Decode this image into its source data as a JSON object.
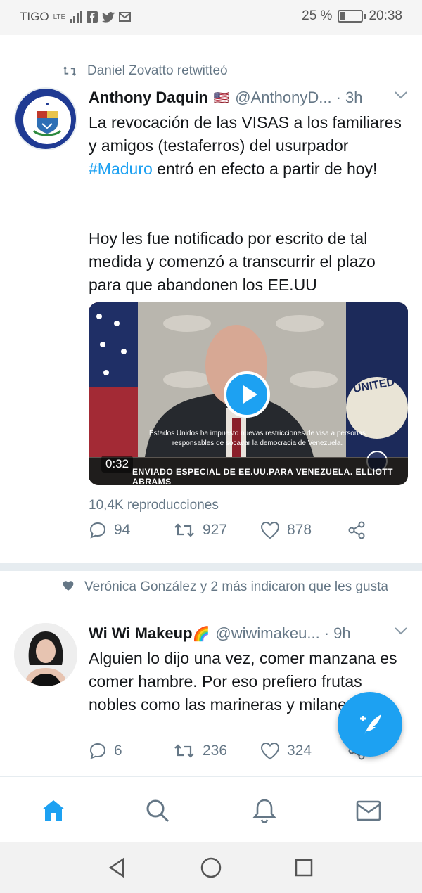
{
  "status_bar": {
    "carrier": "TIGO",
    "network": "LTE",
    "battery_percent": "25 %",
    "battery_level": 0.25,
    "time": "20:38"
  },
  "tweets": [
    {
      "context_icon": "retweet-icon",
      "context": "Daniel Zovatto retwitteó",
      "name": "Anthony Daquin",
      "flag": "🇺🇸",
      "handle": "@AnthonyD...",
      "time": "· 3h",
      "text_part1": "La revocación de las VISAS a los familiares y amigos (testaferros) del usurpador ",
      "hashtag": "#Maduro",
      "text_part2": " entró en efecto a partir de hoy!",
      "text_paragraph2": "Hoy les fue notificado por escrito de tal medida y comenzó a transcurrir el plazo para que abandonen los EE.UU",
      "media": {
        "duration": "0:32",
        "caption": "Estados Unidos ha impuesto nuevas restricciones de visa a personas responsables de socavar la democracia de Venezuela.",
        "lower_third": "ENVIADO ESPECIAL DE EE.UU.PARA VENEZUELA. ELLIOTT ABRAMS",
        "flag_text": "UNITED"
      },
      "views": "10,4K reproducciones",
      "replies": "94",
      "retweets": "927",
      "likes": "878"
    },
    {
      "context_icon": "heart-icon",
      "context": "Verónica González y 2 más indicaron que les gusta",
      "name": "Wi Wi Makeup",
      "emoji": "🌈",
      "handle": "@wiwimakeu...",
      "time": "· 9h",
      "text": "Alguien lo dijo una vez, comer manzana es comer hambre. Por eso prefiero frutas nobles como las marineras y milanesas.",
      "replies": "6",
      "retweets": "236",
      "likes": "324"
    }
  ],
  "colors": {
    "accent": "#1da1f2",
    "secondary_text": "#657786",
    "primary_text": "#14171a"
  }
}
